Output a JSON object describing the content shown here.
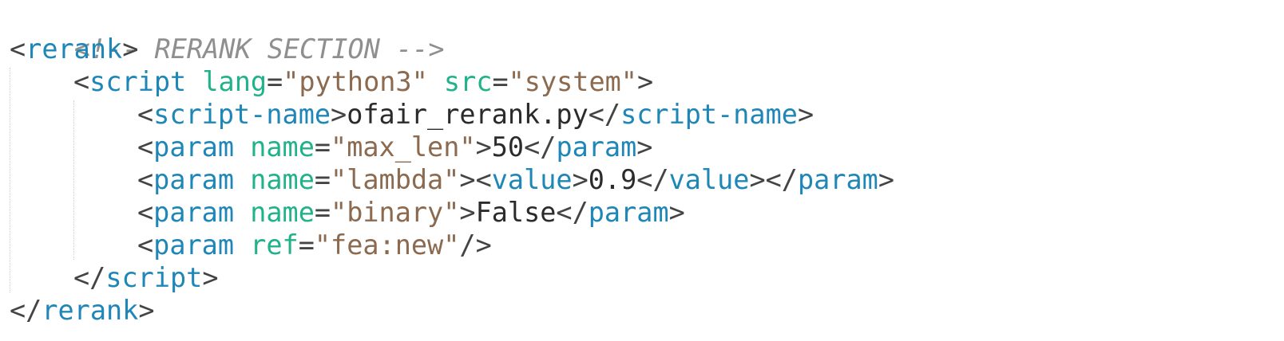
{
  "comment": "<!-- RERANK SECTION -->",
  "tags": {
    "rerank": "rerank",
    "script": "script",
    "script_name": "script-name",
    "param": "param",
    "value": "value"
  },
  "attrs": {
    "lang": "lang",
    "src": "src",
    "name": "name",
    "ref": "ref"
  },
  "values": {
    "lang": "python3",
    "src": "system",
    "script_name": "ofair_rerank.py",
    "param1_name": "max_len",
    "param1_value": "50",
    "param2_name": "lambda",
    "param2_value": "0.9",
    "param3_name": "binary",
    "param3_value": "False",
    "param4_ref": "fea:new"
  },
  "colors": {
    "tag": "#1f86b8",
    "attribute": "#20b28a",
    "string": "#8c6a4f",
    "comment": "#8f8f8f",
    "text": "#2b2b2b"
  }
}
